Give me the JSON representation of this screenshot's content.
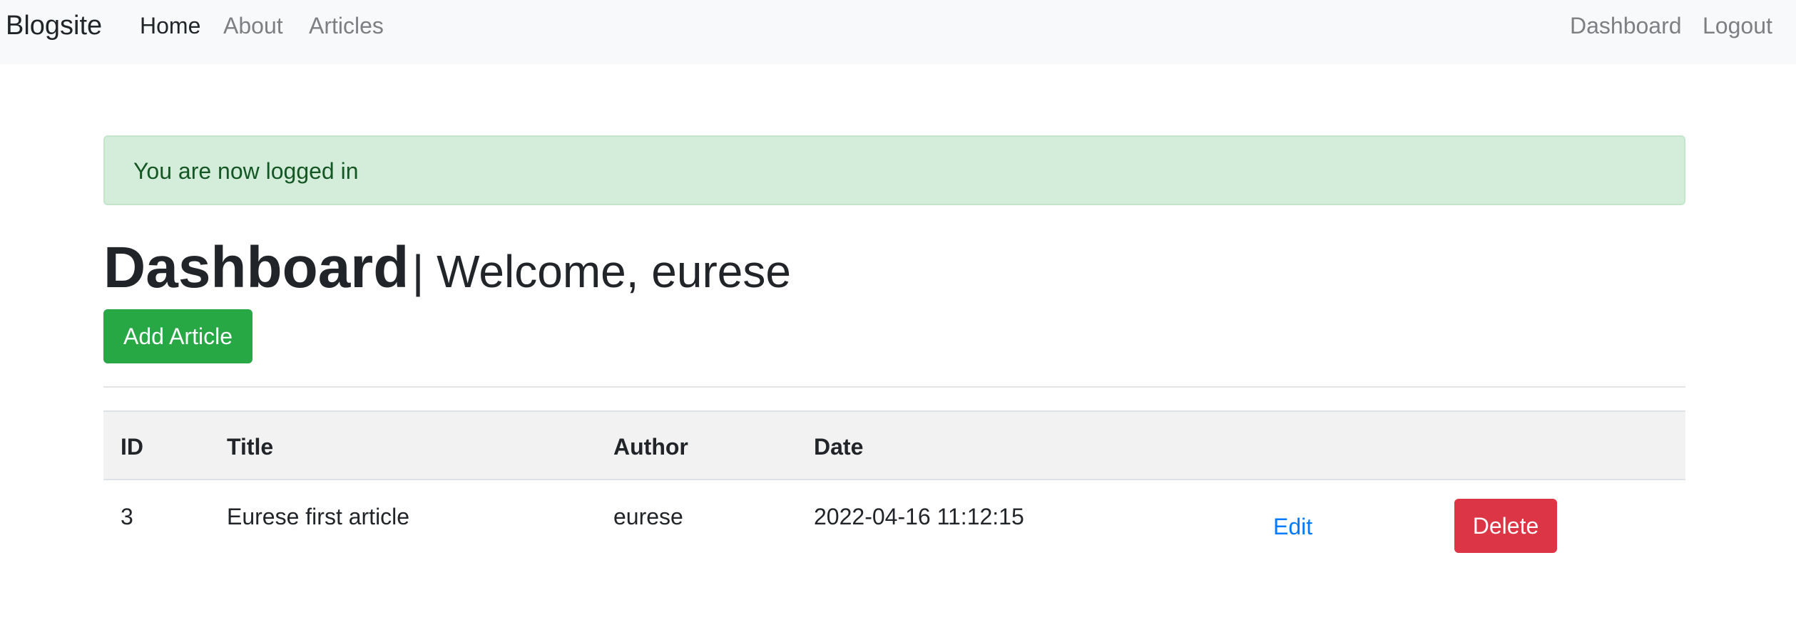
{
  "navbar": {
    "brand": "Blogsite",
    "left_links": [
      "Home",
      "About",
      "Articles"
    ],
    "right_links": [
      "Dashboard",
      "Logout"
    ]
  },
  "alert": {
    "message": "You are now logged in"
  },
  "page": {
    "title": "Dashboard",
    "welcome": "| Welcome, eurese",
    "add_button": "Add Article"
  },
  "table": {
    "headers": [
      "ID",
      "Title",
      "Author",
      "Date"
    ],
    "rows": [
      {
        "id": "3",
        "title": "Eurese first article",
        "author": "eurese",
        "date": "2022-04-16 11:12:15",
        "edit_label": "Edit",
        "delete_label": "Delete"
      }
    ]
  },
  "colors": {
    "navbar_bg": "#f8f9fa",
    "alert_bg": "#d4edda",
    "alert_text": "#155724",
    "success": "#28a745",
    "danger": "#dc3545",
    "link": "#007bff",
    "table_head_bg": "#f2f2f2"
  }
}
